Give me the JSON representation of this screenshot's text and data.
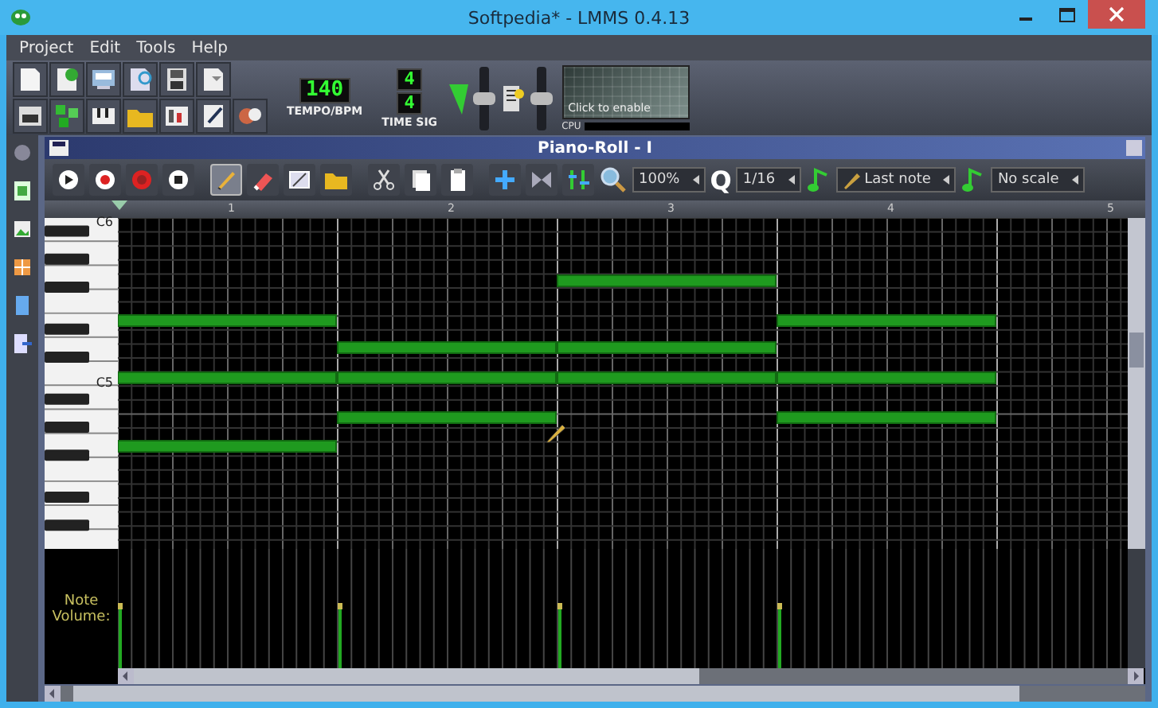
{
  "window": {
    "title": "Softpedia* - LMMS 0.4.13"
  },
  "menu": [
    "Project",
    "Edit",
    "Tools",
    "Help"
  ],
  "toolbar": {
    "tempo": {
      "value": "140",
      "label": "TEMPO/BPM"
    },
    "time_signature": {
      "numerator": "4",
      "denominator": "4",
      "label": "TIME SIG"
    },
    "master_volume": {
      "level": 0.5
    },
    "master_pitch": {
      "level": 0.5
    },
    "cpu_graph": {
      "hint": "Click to enable",
      "label": "CPU"
    }
  },
  "piano_roll": {
    "title": "Piano-Roll - I",
    "edit_modes": [
      {
        "kind": "draw",
        "selected": true
      },
      {
        "kind": "erase",
        "selected": false
      },
      {
        "kind": "select",
        "selected": false
      },
      {
        "kind": "detune",
        "selected": false
      }
    ],
    "zoom": "100%",
    "quantize_label": "Q",
    "quantize": "1/16",
    "note_length": "Last note",
    "scale": "No scale",
    "ruler": [
      "1",
      "2",
      "3",
      "4",
      "5"
    ],
    "keys": [
      "C6",
      "C5"
    ],
    "note_volume_label": "Note Volume:"
  }
}
